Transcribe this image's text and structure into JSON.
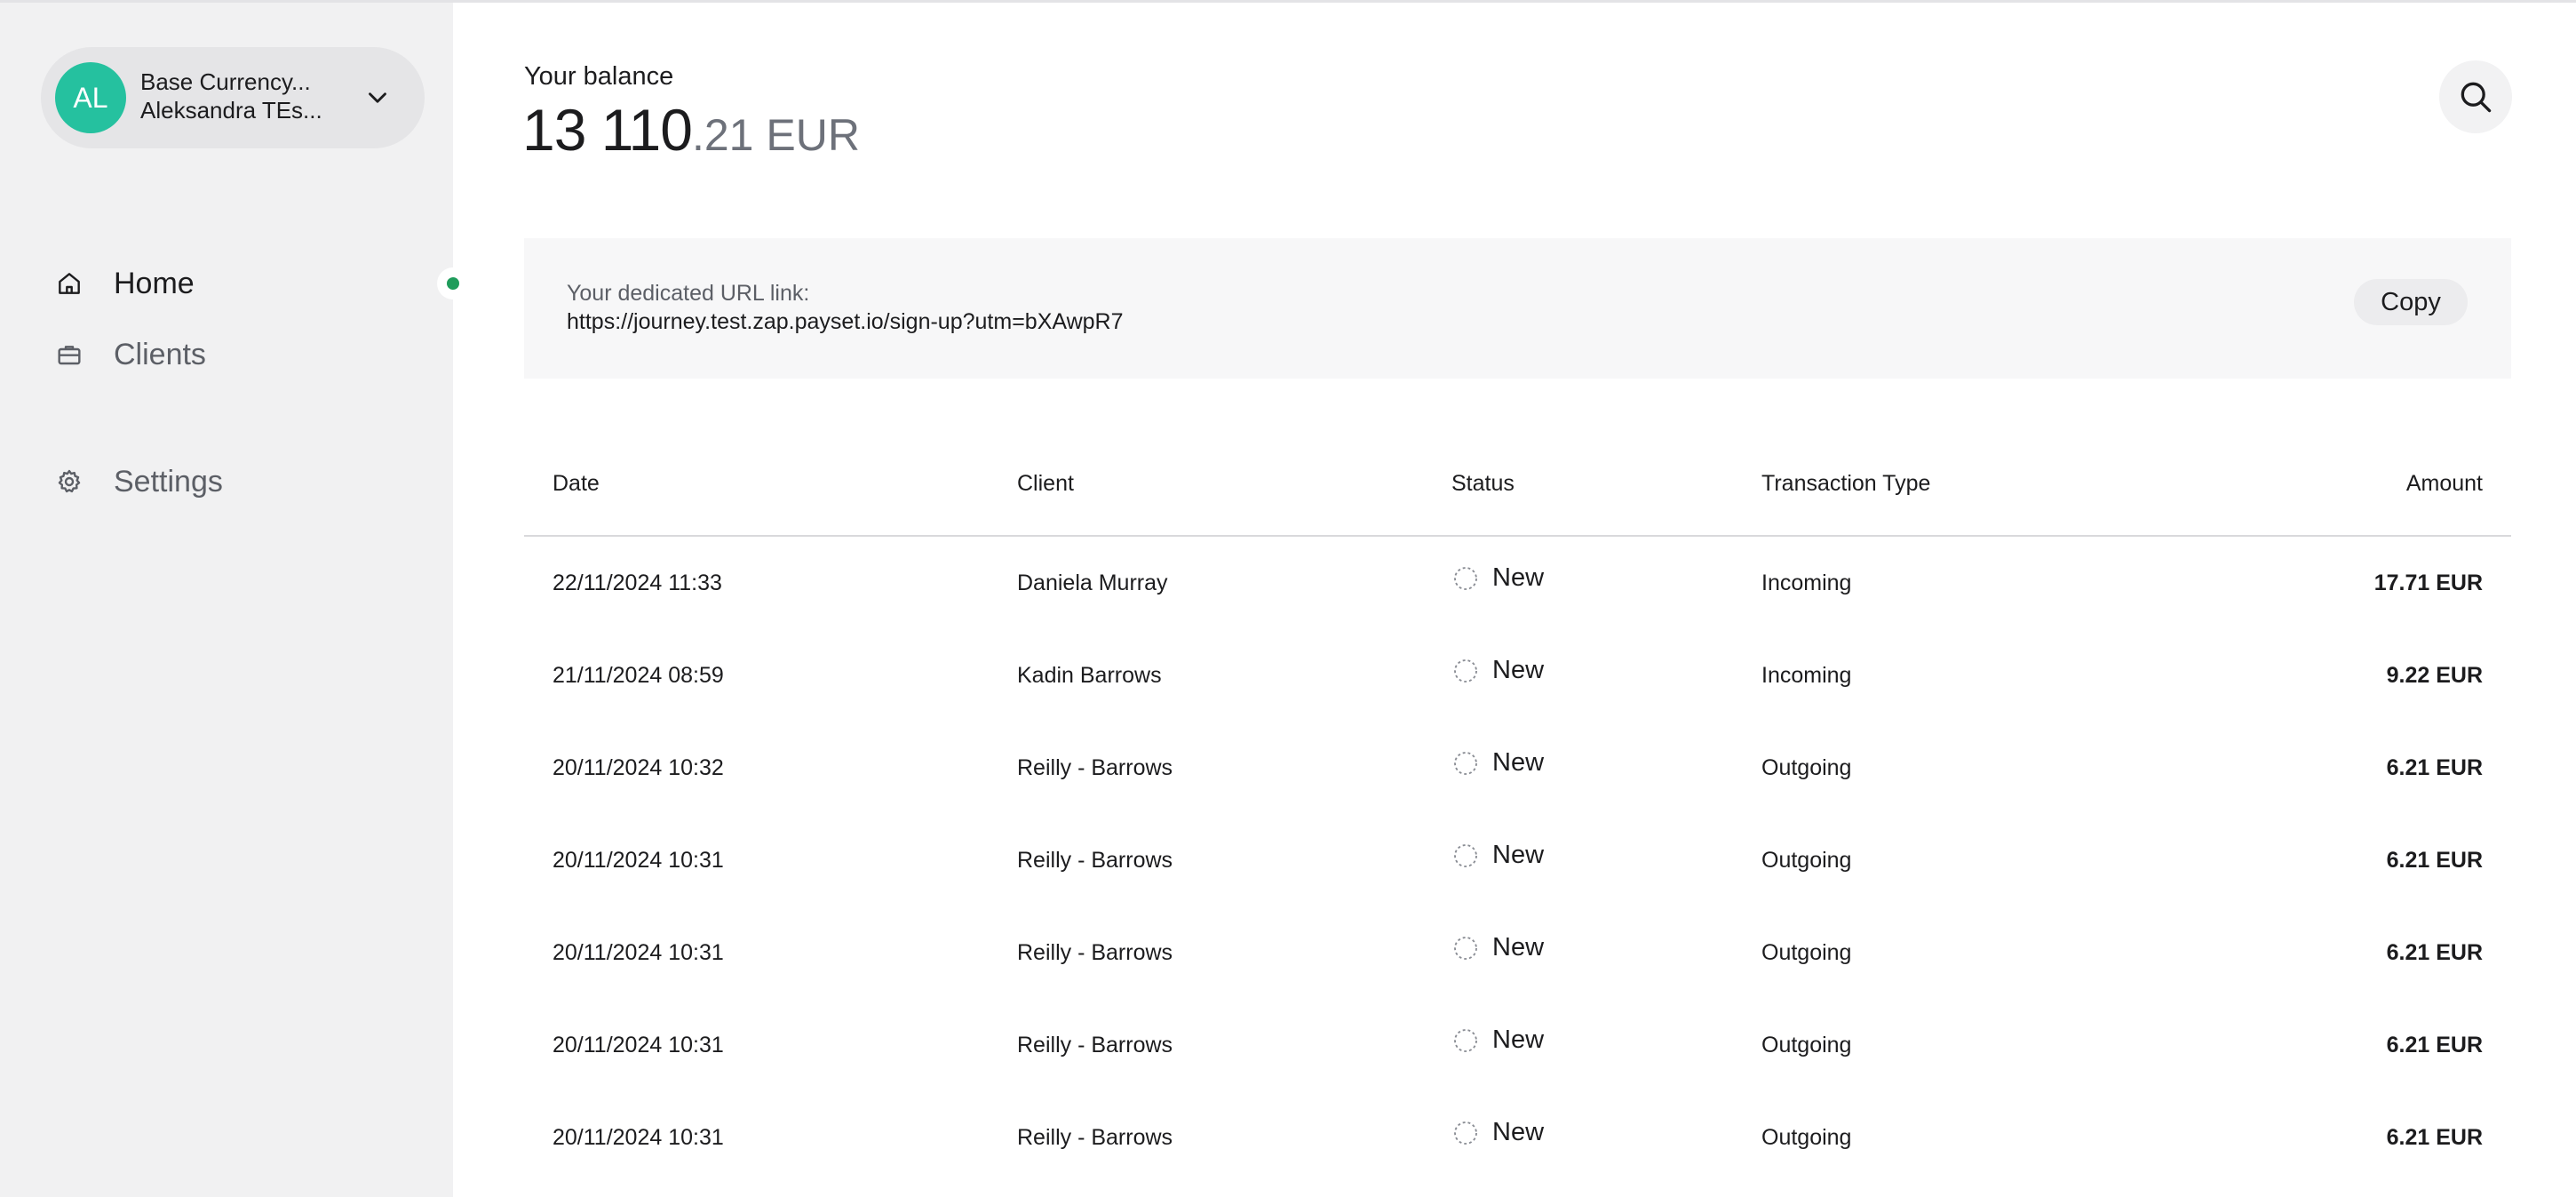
{
  "account": {
    "initials": "AL",
    "line1": "Base Currency...",
    "line2": "Aleksandra TEs...",
    "avatar_color": "#25c19f"
  },
  "nav": {
    "home": "Home",
    "clients": "Clients",
    "settings": "Settings",
    "active": "home",
    "active_color": "#1f9c5b"
  },
  "balance": {
    "label": "Your balance",
    "integer": "13 110",
    "decimal": ".21 EUR"
  },
  "url_card": {
    "label": "Your dedicated URL link:",
    "url": "https://journey.test.zap.payset.io/sign-up?utm=bXAwpR7",
    "copy_label": "Copy"
  },
  "table": {
    "headers": {
      "date": "Date",
      "client": "Client",
      "status": "Status",
      "type": "Transaction Type",
      "amount": "Amount"
    },
    "rows": [
      {
        "date": "22/11/2024 11:33",
        "client": "Daniela Murray",
        "status": "New",
        "type": "Incoming",
        "amount": "17.71 EUR"
      },
      {
        "date": "21/11/2024 08:59",
        "client": "Kadin Barrows",
        "status": "New",
        "type": "Incoming",
        "amount": "9.22 EUR"
      },
      {
        "date": "20/11/2024 10:32",
        "client": "Reilly - Barrows",
        "status": "New",
        "type": "Outgoing",
        "amount": "6.21 EUR"
      },
      {
        "date": "20/11/2024 10:31",
        "client": "Reilly - Barrows",
        "status": "New",
        "type": "Outgoing",
        "amount": "6.21 EUR"
      },
      {
        "date": "20/11/2024 10:31",
        "client": "Reilly - Barrows",
        "status": "New",
        "type": "Outgoing",
        "amount": "6.21 EUR"
      },
      {
        "date": "20/11/2024 10:31",
        "client": "Reilly - Barrows",
        "status": "New",
        "type": "Outgoing",
        "amount": "6.21 EUR"
      },
      {
        "date": "20/11/2024 10:31",
        "client": "Reilly - Barrows",
        "status": "New",
        "type": "Outgoing",
        "amount": "6.21 EUR"
      }
    ]
  },
  "icons": {
    "home": "home-icon",
    "clients": "briefcase-icon",
    "settings": "gear-icon",
    "search": "search-icon",
    "account_toggle": "chevron-down-icon",
    "status": "pending-status-icon"
  }
}
